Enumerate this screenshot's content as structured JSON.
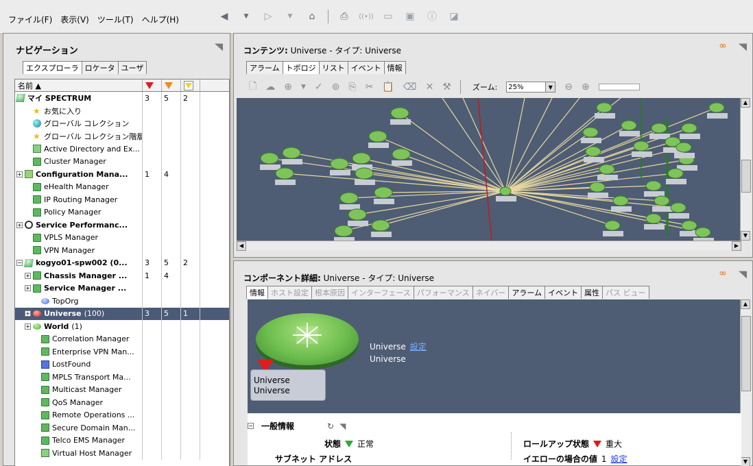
{
  "menu": [
    "ファイル(F)",
    "表示(V)",
    "ツール(T)",
    "ヘルプ(H)"
  ],
  "nav": {
    "title": "ナビゲーション",
    "tabs": [
      "エクスプローラ",
      "ロケータ",
      "ユーザ"
    ],
    "column_name": "名前 ▲",
    "rows": [
      {
        "label": "マイ SPECTRUM",
        "c1": "3",
        "c2": "5",
        "c3": "2"
      },
      {
        "label": "お気に入り",
        "c1": "",
        "c2": "",
        "c3": ""
      },
      {
        "label": "グローバル コレクション",
        "c1": "",
        "c2": "",
        "c3": ""
      },
      {
        "label": "グローバル コレクション階層",
        "c1": "",
        "c2": "",
        "c3": ""
      },
      {
        "label": "Active Directory and Ex...",
        "c1": "",
        "c2": "",
        "c3": ""
      },
      {
        "label": "Cluster Manager",
        "c1": "",
        "c2": "",
        "c3": ""
      },
      {
        "label": "Configuration Mana...",
        "c1": "1",
        "c2": "4",
        "c3": ""
      },
      {
        "label": "eHealth Manager",
        "c1": "",
        "c2": "",
        "c3": ""
      },
      {
        "label": "IP Routing Manager",
        "c1": "",
        "c2": "",
        "c3": ""
      },
      {
        "label": "Policy Manager",
        "c1": "",
        "c2": "",
        "c3": ""
      },
      {
        "label": "Service Performanc...",
        "c1": "",
        "c2": "",
        "c3": ""
      },
      {
        "label": "VPLS Manager",
        "c1": "",
        "c2": "",
        "c3": ""
      },
      {
        "label": "VPN Manager",
        "c1": "",
        "c2": "",
        "c3": ""
      },
      {
        "label": "kogyo01-spw002 (0...",
        "c1": "3",
        "c2": "5",
        "c3": "2"
      },
      {
        "label": "Chassis Manager ...",
        "c1": "1",
        "c2": "4",
        "c3": ""
      },
      {
        "label": "Service Manager ...",
        "c1": "",
        "c2": "",
        "c3": ""
      },
      {
        "label": "TopOrg",
        "c1": "",
        "c2": "",
        "c3": ""
      },
      {
        "label": "Universe",
        "count": "(100)",
        "c1": "3",
        "c2": "5",
        "c3": "1"
      },
      {
        "label": "World",
        "count": "(1)",
        "c1": "",
        "c2": "",
        "c3": ""
      },
      {
        "label": "Correlation Manager",
        "c1": "",
        "c2": "",
        "c3": ""
      },
      {
        "label": "Enterprise VPN Man...",
        "c1": "",
        "c2": "",
        "c3": ""
      },
      {
        "label": "LostFound",
        "c1": "",
        "c2": "",
        "c3": ""
      },
      {
        "label": "MPLS Transport Ma...",
        "c1": "",
        "c2": "",
        "c3": ""
      },
      {
        "label": "Multicast Manager",
        "c1": "",
        "c2": "",
        "c3": ""
      },
      {
        "label": "QoS Manager",
        "c1": "",
        "c2": "",
        "c3": ""
      },
      {
        "label": "Remote Operations ...",
        "c1": "",
        "c2": "",
        "c3": ""
      },
      {
        "label": "Secure Domain Man...",
        "c1": "",
        "c2": "",
        "c3": ""
      },
      {
        "label": "Telco EMS Manager",
        "c1": "",
        "c2": "",
        "c3": ""
      },
      {
        "label": "Virtual Host Manager",
        "c1": "",
        "c2": "",
        "c3": ""
      }
    ]
  },
  "content": {
    "title_bold": "コンテンツ:",
    "title_rest": " Universe - タイプ: Universe",
    "tabs": [
      "アラーム",
      "トポロジ",
      "リスト",
      "イベント",
      "情報"
    ],
    "zoom_label": "ズーム:",
    "zoom_value": "25%"
  },
  "details": {
    "title_bold": "コンポーネント詳細:",
    "title_rest": " Universe - タイプ: Universe",
    "tabs": [
      "情報",
      "ホスト設定",
      "根本原因",
      "インターフェース",
      "パフォーマンス",
      "ネイバー",
      "アラーム",
      "イベント",
      "属性",
      "パス ビュー"
    ],
    "box_line1": "Universe",
    "box_line2": "Universe",
    "info_name": "Universe",
    "info_link": "設定",
    "info_type": "Universe",
    "general_title": "一般情報",
    "status_label": "状態",
    "status_value": "正常",
    "rollup_label": "ロールアップ状態",
    "rollup_value": "重大",
    "subnet_label": "サブネット アドレス",
    "yellow_label": "イエローの場合の値",
    "yellow_value": "1",
    "yellow_link": "設定"
  },
  "colors": {
    "critical": "#e01c1c",
    "major": "#f08a1a",
    "minor": "#f0d41a",
    "normal": "#2ea83c",
    "topology_bg": "#4e5d74"
  }
}
